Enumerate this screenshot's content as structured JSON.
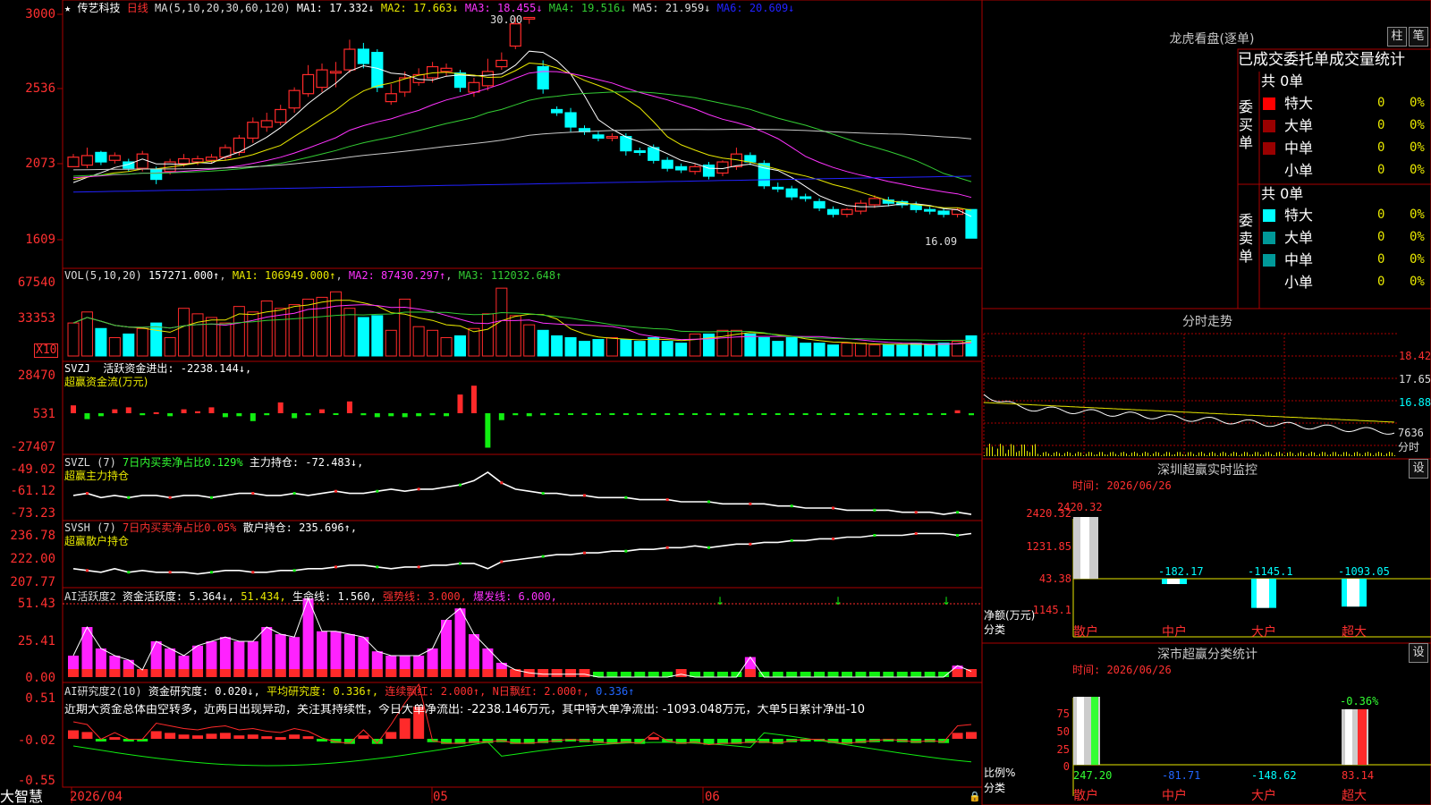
{
  "colors": {
    "up": "#ff2a2a",
    "down": "#00ffff",
    "ma1": "#ffffff",
    "ma2": "#e8e800",
    "ma3": "#ff33ff",
    "ma4": "#33cc33",
    "ma5": "#c8c8c8",
    "ma6": "#2222ff",
    "grid": "#aa0000"
  },
  "main": {
    "stock_name": "传艺科技",
    "period": "日线",
    "ma_params": "MA(5,10,20,30,60,120)",
    "ma_values": [
      {
        "label": "MA1:",
        "value": "17.332↓"
      },
      {
        "label": "MA2:",
        "value": "17.663↓"
      },
      {
        "label": "MA3:",
        "value": "18.455↓"
      },
      {
        "label": "MA4:",
        "value": "19.516↓"
      },
      {
        "label": "MA5:",
        "value": "21.959↓"
      },
      {
        "label": "MA6:",
        "value": "20.609↓"
      }
    ],
    "y_labels": [
      "3000",
      "2536",
      "2073",
      "1609"
    ],
    "high_marker": "30.00",
    "low_marker": "16.09"
  },
  "vol": {
    "title": "VOL(5,10,20)",
    "value": "157271.000↑",
    "ma1": "MA1: 106949.000↑",
    "ma2": "MA2: 87430.297↑",
    "ma3": "MA3: 112032.648↑",
    "y_labels": [
      "67540",
      "33353"
    ],
    "unit": "X10"
  },
  "svzj": {
    "title": "SVZJ",
    "desc": "活跃资金进出: -2238.144↓,",
    "sub": "超赢资金流(万元)",
    "y_labels": [
      "28470",
      "531",
      "-27407"
    ]
  },
  "svzl": {
    "title": "SVZL (7)",
    "pct": "7日内买卖净占比0.129%",
    "desc": "主力持仓: -72.483↓,",
    "sub": "超赢主力持仓",
    "y_labels": [
      "-49.02",
      "-61.12",
      "-73.23"
    ]
  },
  "svsh": {
    "title": "SVSH (7)",
    "pct": "7日内买卖净占比0.05%",
    "desc": "散户持仓: 235.696↑,",
    "sub": "超赢散户持仓",
    "y_labels": [
      "236.78",
      "222.00",
      "207.77"
    ]
  },
  "ai1": {
    "title": "AI活跃度2",
    "a": "资金活跃度: 5.364↓,",
    "b": "51.434,",
    "c": "生命线: 1.560,",
    "d": "强势线: 3.000,",
    "e": "爆发线: 6.000,",
    "y_labels": [
      "51.43",
      "25.41",
      "0.00"
    ]
  },
  "ai2": {
    "title": "AI研究度2(10)",
    "a": "资金研究度: 0.020↓,",
    "b": "平均研究度: 0.336↑,",
    "c": "连续飘红: 2.000↑,",
    "d": "N日飘红: 2.000↑,",
    "e": "0.336↑",
    "text": "近期大资金总体由空转多，近两日出现异动，关注其持续性，今日大单净流出: -2238.146万元，其中特大单净流出: -1093.048万元，大单5日累计净出-10",
    "y_labels": [
      "0.51",
      "-0.02",
      "-0.55"
    ]
  },
  "xaxis": {
    "labels": [
      "2026/04",
      "05",
      "06"
    ]
  },
  "bottom_left": "大智慧",
  "dragon": {
    "title": "龙虎看盘(逐单)",
    "tabs": [
      "柱",
      "笔"
    ],
    "header": "已成交委托单成交量统计",
    "buy": {
      "side": "委买单",
      "total": "共 0单",
      "rows": [
        {
          "name": "特大",
          "val": "0",
          "pct": "0%"
        },
        {
          "name": "大单",
          "val": "0",
          "pct": "0%"
        },
        {
          "name": "中单",
          "val": "0",
          "pct": "0%"
        },
        {
          "name": "小单",
          "val": "0",
          "pct": "0%"
        }
      ]
    },
    "sell": {
      "side": "委卖单",
      "total": "共 0单",
      "rows": [
        {
          "name": "特大",
          "val": "0",
          "pct": "0%"
        },
        {
          "name": "大单",
          "val": "0",
          "pct": "0%"
        },
        {
          "name": "中单",
          "val": "0",
          "pct": "0%"
        },
        {
          "name": "小单",
          "val": "0",
          "pct": "0%"
        }
      ]
    }
  },
  "intraday": {
    "title": "分时走势",
    "y_labels": [
      "18.42",
      "17.65",
      "16.88"
    ],
    "vol_label": "7636",
    "unit": "分时"
  },
  "monitor": {
    "title": "深圳超赢实时监控",
    "btn": "设",
    "time": "时间: 2026/06/26",
    "y_labels": [
      "2420.32",
      "1231.85",
      "43.38",
      "-1145.1"
    ],
    "ylabel": "净额(万元)",
    "xlabel": "分类",
    "categories": [
      "散户",
      "中户",
      "大户",
      "超大"
    ],
    "values": [
      "2420.32",
      "-182.17",
      "-1145.1",
      "-1093.05"
    ]
  },
  "stats": {
    "title": "深市超赢分类统计",
    "btn": "设",
    "time": "时间: 2026/06/26",
    "y_labels": [
      "75",
      "50",
      "25",
      "0"
    ],
    "ylabel": "比例%",
    "xlabel": "分类",
    "categories": [
      "散户",
      "中户",
      "大户",
      "超大"
    ],
    "values": [
      "247.20",
      "-81.71",
      "-148.62",
      "83.14"
    ],
    "top_label": "-0.36%"
  },
  "chart_data": [
    {
      "type": "candlestick",
      "title": "传艺科技 日线",
      "ylim": [
        16.0,
        30.2
      ],
      "candles": [
        [
          20.6,
          21.2,
          20.9,
          21.4
        ],
        [
          20.7,
          21.3,
          20.5,
          21.8
        ],
        [
          21.5,
          20.9,
          20.7,
          21.6
        ],
        [
          21.0,
          21.3,
          20.8,
          21.5
        ],
        [
          20.9,
          20.5,
          20.3,
          21.1
        ],
        [
          20.5,
          21.4,
          20.3,
          21.6
        ],
        [
          20.4,
          19.8,
          19.5,
          20.6
        ],
        [
          20.3,
          20.9,
          20.1,
          21.1
        ],
        [
          20.8,
          21.1,
          20.6,
          21.4
        ],
        [
          20.9,
          21.1,
          20.7,
          21.3
        ],
        [
          21.0,
          21.2,
          20.8,
          21.4
        ],
        [
          21.2,
          21.8,
          21.0,
          22.0
        ],
        [
          21.5,
          22.4,
          21.3,
          22.6
        ],
        [
          22.4,
          23.4,
          22.1,
          23.7
        ],
        [
          23.1,
          23.5,
          22.8,
          24.0
        ],
        [
          23.4,
          24.2,
          23.2,
          24.5
        ],
        [
          24.3,
          25.4,
          24.0,
          25.6
        ],
        [
          25.2,
          26.4,
          25.0,
          27.0
        ],
        [
          25.6,
          26.7,
          25.3,
          27.1
        ],
        [
          26.5,
          26.6,
          25.6,
          27.2
        ],
        [
          26.7,
          28.0,
          26.5,
          28.6
        ],
        [
          28.0,
          27.1,
          26.8,
          28.4
        ],
        [
          27.8,
          25.6,
          25.3,
          28.0
        ],
        [
          24.7,
          25.2,
          24.5,
          25.8
        ],
        [
          25.3,
          26.2,
          25.0,
          26.6
        ],
        [
          25.9,
          26.4,
          25.7,
          26.8
        ],
        [
          26.2,
          26.9,
          25.9,
          27.2
        ],
        [
          26.6,
          26.8,
          26.3,
          27.1
        ],
        [
          26.5,
          25.6,
          25.3,
          26.7
        ],
        [
          25.3,
          25.9,
          25.0,
          26.2
        ],
        [
          25.7,
          26.6,
          25.4,
          27.4
        ],
        [
          26.9,
          27.3,
          26.7,
          27.8
        ],
        [
          28.2,
          29.6,
          28.0,
          30.0
        ],
        [
          29.9,
          30.0,
          29.6,
          30.0
        ],
        [
          26.9,
          25.5,
          25.2,
          27.3
        ],
        [
          24.2,
          24.0,
          23.8,
          24.4
        ],
        [
          24.0,
          23.1,
          22.8,
          24.3
        ],
        [
          23.0,
          22.8,
          22.6,
          23.2
        ],
        [
          22.6,
          22.4,
          22.2,
          22.8
        ],
        [
          22.4,
          22.5,
          22.2,
          22.7
        ],
        [
          22.5,
          21.6,
          21.3,
          22.7
        ],
        [
          21.6,
          21.5,
          21.3,
          21.8
        ],
        [
          21.8,
          21.0,
          20.8,
          22.0
        ],
        [
          21.0,
          20.5,
          20.3,
          21.2
        ],
        [
          20.6,
          20.4,
          20.2,
          20.8
        ],
        [
          20.3,
          20.6,
          20.1,
          20.8
        ],
        [
          20.7,
          20.0,
          19.8,
          20.9
        ],
        [
          20.2,
          20.9,
          20.0,
          21.0
        ],
        [
          20.6,
          21.4,
          20.4,
          21.8
        ],
        [
          21.3,
          20.9,
          20.7,
          21.5
        ],
        [
          20.8,
          19.4,
          19.2,
          21.0
        ],
        [
          19.3,
          19.2,
          19.0,
          19.6
        ],
        [
          19.2,
          18.7,
          18.5,
          19.4
        ],
        [
          18.7,
          18.6,
          18.4,
          18.9
        ],
        [
          18.4,
          18.0,
          17.8,
          18.6
        ],
        [
          17.9,
          17.6,
          17.4,
          18.1
        ],
        [
          17.6,
          17.9,
          17.4,
          18.0
        ],
        [
          17.8,
          18.3,
          17.6,
          18.5
        ],
        [
          18.2,
          18.6,
          18.0,
          18.8
        ],
        [
          18.5,
          18.3,
          18.1,
          18.7
        ],
        [
          18.4,
          18.2,
          18.0,
          18.5
        ],
        [
          18.2,
          17.9,
          17.7,
          18.4
        ],
        [
          17.9,
          17.8,
          17.6,
          18.1
        ],
        [
          17.8,
          17.6,
          17.4,
          18.0
        ],
        [
          17.6,
          17.9,
          17.4,
          18.0
        ],
        [
          17.9,
          16.1,
          16.1,
          17.9
        ]
      ]
    },
    {
      "type": "bar",
      "title": "VOL(5,10,20)",
      "values": [
        18,
        24,
        15,
        10,
        12,
        15,
        18,
        10,
        26,
        23,
        21,
        18,
        27,
        24,
        30,
        26,
        28,
        31,
        32,
        35,
        26,
        21,
        22,
        14,
        31,
        16,
        14,
        10,
        11,
        15,
        23,
        37,
        22,
        17,
        14,
        11,
        10,
        8,
        9,
        10,
        9,
        8,
        10,
        8,
        7,
        12,
        12,
        14,
        14,
        12,
        10,
        8,
        10,
        7,
        7,
        6,
        7,
        7,
        6,
        6,
        6,
        7,
        6,
        7,
        8,
        11
      ]
    },
    {
      "type": "bar",
      "title": "超赢资金流(万元)",
      "values": [
        8,
        -6,
        -3,
        4,
        6,
        -2,
        1,
        -3,
        4,
        2,
        6,
        -4,
        -3,
        -8,
        -2,
        11,
        -5,
        -2,
        4,
        -1,
        12,
        -2,
        -4,
        -3,
        -4,
        -3,
        -2,
        -3,
        19,
        28,
        -35,
        -7,
        -2,
        -3,
        -2,
        -1,
        -1,
        -1,
        -1,
        -1,
        -1,
        -1,
        -1,
        -1,
        -1,
        -1,
        -1,
        -2,
        -2,
        -1,
        -1,
        -1,
        -1,
        -1,
        -1,
        -1,
        -1,
        -1,
        -1,
        -1,
        -1,
        -1,
        -1,
        -1,
        3,
        -2
      ]
    },
    {
      "type": "line",
      "title": "超赢主力持仓",
      "ylim": [
        -73.23,
        -49.02
      ],
      "values": [
        -63,
        -62,
        -64,
        -63,
        -64,
        -63,
        -63,
        -64,
        -63,
        -63,
        -64,
        -63,
        -62,
        -62,
        -63,
        -63,
        -62,
        -63,
        -62,
        -61,
        -62,
        -62,
        -61,
        -60,
        -61,
        -60,
        -60,
        -59,
        -58,
        -56,
        -52,
        -57,
        -60,
        -61,
        -62,
        -62,
        -63,
        -63,
        -64,
        -64,
        -64,
        -65,
        -65,
        -65,
        -66,
        -66,
        -66,
        -67,
        -67,
        -67,
        -67,
        -68,
        -68,
        -69,
        -69,
        -69,
        -70,
        -70,
        -70,
        -70,
        -71,
        -71,
        -71,
        -72,
        -71,
        -72
      ]
    },
    {
      "type": "line",
      "title": "超赢散户持仓",
      "ylim": [
        207.77,
        236.78
      ],
      "values": [
        216,
        215,
        214,
        216,
        214,
        215,
        214,
        214,
        214,
        213,
        214,
        215,
        215,
        214,
        214,
        215,
        215,
        216,
        216,
        217,
        218,
        218,
        217,
        216,
        217,
        217,
        218,
        218,
        219,
        219,
        216,
        220,
        221,
        222,
        223,
        224,
        224,
        225,
        225,
        226,
        226,
        227,
        227,
        228,
        228,
        229,
        228,
        229,
        230,
        230,
        231,
        231,
        232,
        232,
        233,
        233,
        234,
        234,
        235,
        235,
        235,
        236,
        236,
        236,
        235,
        236
      ]
    },
    {
      "type": "bar",
      "title": "AI活跃度2",
      "ylim": [
        0,
        51.43
      ],
      "values": [
        15,
        35,
        20,
        15,
        12,
        5,
        25,
        20,
        15,
        22,
        25,
        28,
        25,
        25,
        35,
        30,
        28,
        55,
        32,
        32,
        30,
        28,
        18,
        15,
        15,
        15,
        20,
        40,
        48,
        30,
        20,
        10,
        5,
        3,
        2,
        2,
        2,
        2,
        -2,
        -2,
        -2,
        -2,
        -2,
        -2,
        2,
        -2,
        -2,
        -2,
        -2,
        14,
        -2,
        -2,
        -2,
        -2,
        -2,
        -2,
        -2,
        -2,
        -2,
        -2,
        -2,
        -2,
        -2,
        -2,
        8,
        4
      ]
    },
    {
      "type": "bar",
      "title": "AI研究度2(10)",
      "ylim": [
        -0.55,
        0.51
      ],
      "values": [
        0.1,
        0.08,
        -0.03,
        0.02,
        -0.03,
        -0.03,
        0.09,
        0.07,
        0.05,
        0.04,
        0.06,
        0.07,
        0.04,
        0.05,
        0.03,
        0.02,
        0.05,
        0.03,
        -0.02,
        -0.05,
        -0.06,
        0.04,
        -0.06,
        0.08,
        0.24,
        0.38,
        -0.04,
        -0.06,
        -0.06,
        -0.05,
        -0.05,
        -0.04,
        -0.06,
        -0.06,
        -0.05,
        -0.04,
        -0.03,
        -0.04,
        -0.05,
        -0.06,
        -0.05,
        -0.06,
        0.02,
        -0.04,
        -0.06,
        -0.05,
        -0.07,
        -0.06,
        -0.06,
        -0.05,
        -0.05,
        -0.06,
        -0.04,
        -0.03,
        -0.03,
        -0.05,
        -0.06,
        -0.05,
        -0.04,
        -0.03,
        -0.04,
        -0.05,
        -0.04,
        -0.05,
        0.07,
        0.08
      ]
    }
  ]
}
